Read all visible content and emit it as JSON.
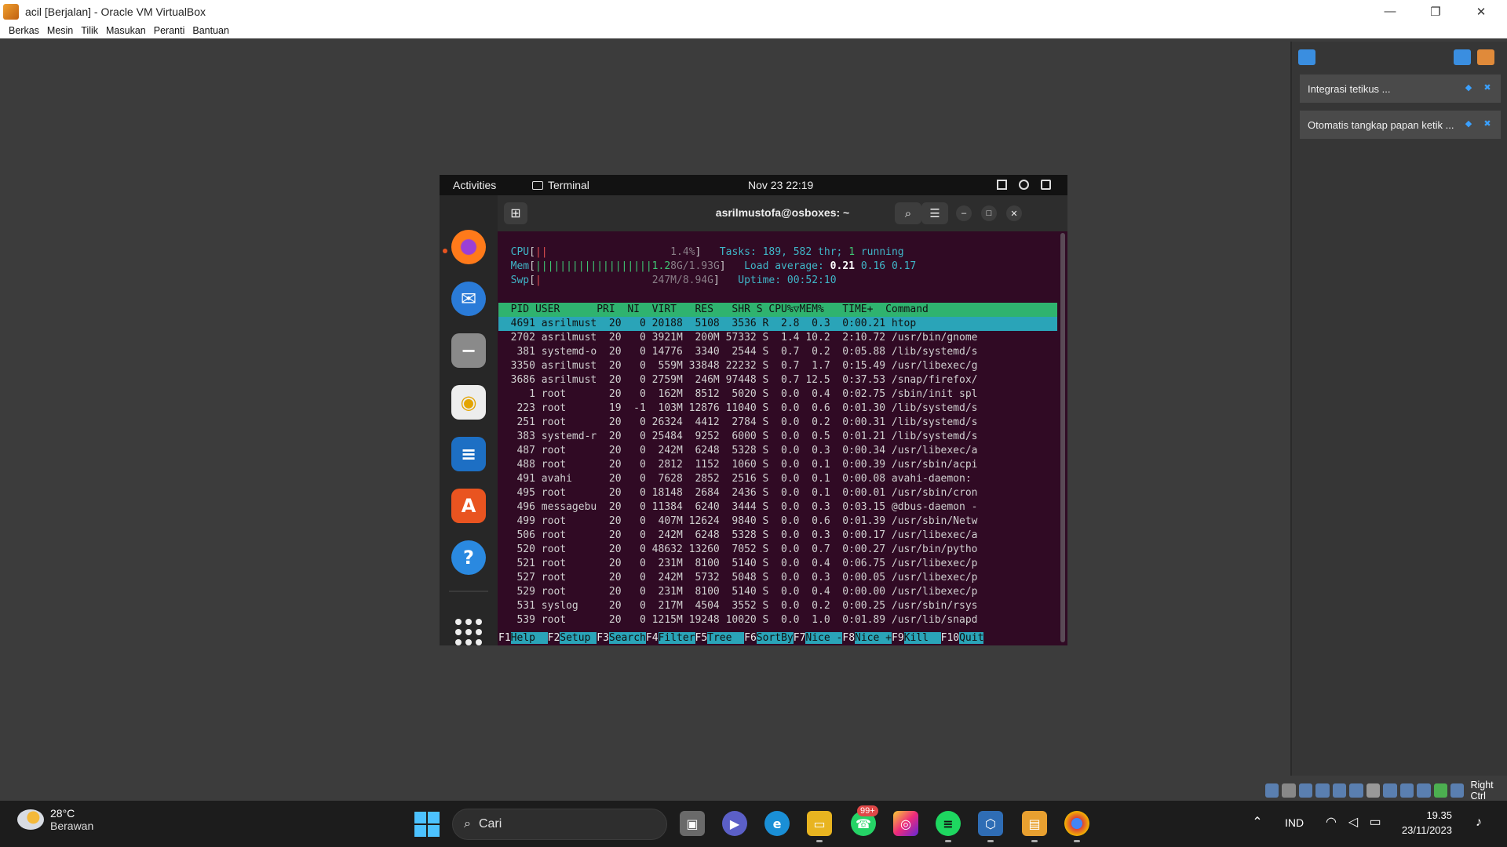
{
  "window": {
    "title": "acil [Berjalan] - Oracle VM VirtualBox"
  },
  "menu": [
    "Berkas",
    "Mesin",
    "Tilik",
    "Masukan",
    "Peranti",
    "Bantuan"
  ],
  "notifications": [
    {
      "text": "Integrasi tetikus ..."
    },
    {
      "text": "Otomatis tangkap papan ketik ..."
    }
  ],
  "host_key": "Right Ctrl",
  "guest": {
    "topbar": {
      "activities": "Activities",
      "app": "Terminal",
      "clock": "Nov 23  22:19"
    },
    "dock_apps": [
      "firefox-icon",
      "thunderbird-icon",
      "files-icon",
      "rhythmbox-icon",
      "writer-icon",
      "app-center-icon",
      "help-icon",
      "show-apps-icon"
    ],
    "terminal": {
      "title": "asrilmustofa@osboxes: ~"
    }
  },
  "htop": {
    "cpu_bar": "||",
    "cpu_val": "1.4%",
    "mem_bar": "|||||||||||||||||||1.2",
    "mem_val": "8G/1.93G",
    "swp_bar": "|",
    "swp_val": "247M/8.94G",
    "tasks": "189",
    "thr": "582",
    "running": "1",
    "load1": "0.21",
    "load5": "0.16",
    "load15": "0.17",
    "uptime": "00:52:10",
    "header": "  PID USER      PRI  NI  VIRT   RES   SHR S CPU%▽MEM%   TIME+  Command",
    "rows": [
      "  4691 asrilmust  20   0 20188  5108  3536 R  2.8  0.3  0:00.21 htop",
      "  2702 asrilmust  20   0 3921M  200M 57332 S  1.4 10.2  2:10.72 /usr/bin/gnome",
      "   381 systemd-o  20   0 14776  3340  2544 S  0.7  0.2  0:05.88 /lib/systemd/s",
      "  3350 asrilmust  20   0  559M 33848 22232 S  0.7  1.7  0:15.49 /usr/libexec/g",
      "  3686 asrilmust  20   0 2759M  246M 97448 S  0.7 12.5  0:37.53 /snap/firefox/",
      "     1 root       20   0  162M  8512  5020 S  0.0  0.4  0:02.75 /sbin/init spl",
      "   223 root       19  -1  103M 12876 11040 S  0.0  0.6  0:01.30 /lib/systemd/s",
      "   251 root       20   0 26324  4412  2784 S  0.0  0.2  0:00.31 /lib/systemd/s",
      "   383 systemd-r  20   0 25484  9252  6000 S  0.0  0.5  0:01.21 /lib/systemd/s",
      "   487 root       20   0  242M  6248  5328 S  0.0  0.3  0:00.34 /usr/libexec/a",
      "   488 root       20   0  2812  1152  1060 S  0.0  0.1  0:00.39 /usr/sbin/acpi",
      "   491 avahi      20   0  7628  2852  2516 S  0.0  0.1  0:00.08 avahi-daemon:",
      "   495 root       20   0 18148  2684  2436 S  0.0  0.1  0:00.01 /usr/sbin/cron",
      "   496 messagebu  20   0 11384  6240  3444 S  0.0  0.3  0:03.15 @dbus-daemon -",
      "   499 root       20   0  407M 12624  9840 S  0.0  0.6  0:01.39 /usr/sbin/Netw",
      "   506 root       20   0  242M  6248  5328 S  0.0  0.3  0:00.17 /usr/libexec/a",
      "   520 root       20   0 48632 13260  7052 S  0.0  0.7  0:00.27 /usr/bin/pytho",
      "   521 root       20   0  231M  8100  5140 S  0.0  0.4  0:06.75 /usr/libexec/p",
      "   527 root       20   0  242M  5732  5048 S  0.0  0.3  0:00.05 /usr/libexec/p",
      "   529 root       20   0  231M  8100  5140 S  0.0  0.4  0:00.00 /usr/libexec/p",
      "   531 syslog     20   0  217M  4504  3552 S  0.0  0.2  0:00.25 /usr/sbin/rsys",
      "   539 root       20   0 1215M 19248 10020 S  0.0  1.0  0:01.89 /usr/lib/snapd"
    ],
    "fkeys": [
      {
        "key": "F1",
        "label": "Help  "
      },
      {
        "key": "F2",
        "label": "Setup "
      },
      {
        "key": "F3",
        "label": "Search"
      },
      {
        "key": "F4",
        "label": "Filter"
      },
      {
        "key": "F5",
        "label": "Tree  "
      },
      {
        "key": "F6",
        "label": "SortBy"
      },
      {
        "key": "F7",
        "label": "Nice -"
      },
      {
        "key": "F8",
        "label": "Nice +"
      },
      {
        "key": "F9",
        "label": "Kill  "
      },
      {
        "key": "F10",
        "label": "Quit"
      }
    ]
  },
  "taskbar": {
    "weather_temp": "28°C",
    "weather_desc": "Berawan",
    "search_placeholder": "Cari",
    "badge": "99+",
    "lang": "IND",
    "time": "19.35",
    "date": "23/11/2023"
  }
}
